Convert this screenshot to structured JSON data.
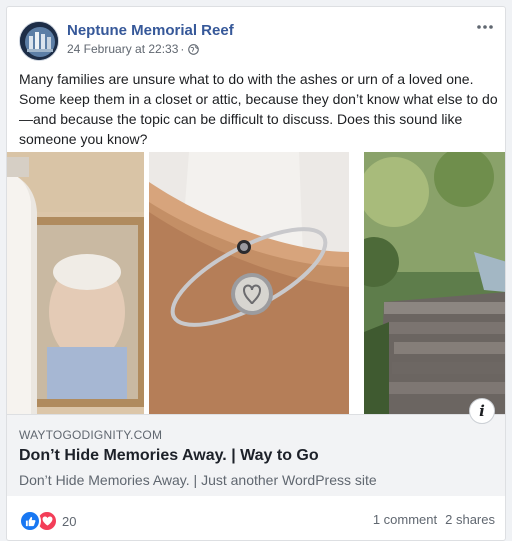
{
  "post": {
    "page_name": "Neptune Memorial Reef",
    "date": "24 February at 22:33",
    "separator": "·",
    "privacy_icon": "globe-icon",
    "more_icon": "more-dots-icon",
    "body": "Many families are unsure what to do with the ashes or urn of a loved one. Some keep them in a closet or attic, because they don’t know what else to do—and because the topic can be difficult to discuss. Does this sound like someone you know?"
  },
  "link": {
    "domain": "WAYTOGODIGNITY.COM",
    "title": "Don’t Hide Memories Away. | Way to Go",
    "description": "Don’t Hide Memories Away. | Just another WordPress site",
    "info_label": "i"
  },
  "engagement": {
    "reaction_icons": [
      "like-icon",
      "love-icon"
    ],
    "reaction_count": "20",
    "comments": "1 comment",
    "shares": "2 shares"
  },
  "colors": {
    "page_name": "#365899",
    "like": "#1877f2",
    "love": "#f33e58",
    "secondary_text": "#606770"
  }
}
